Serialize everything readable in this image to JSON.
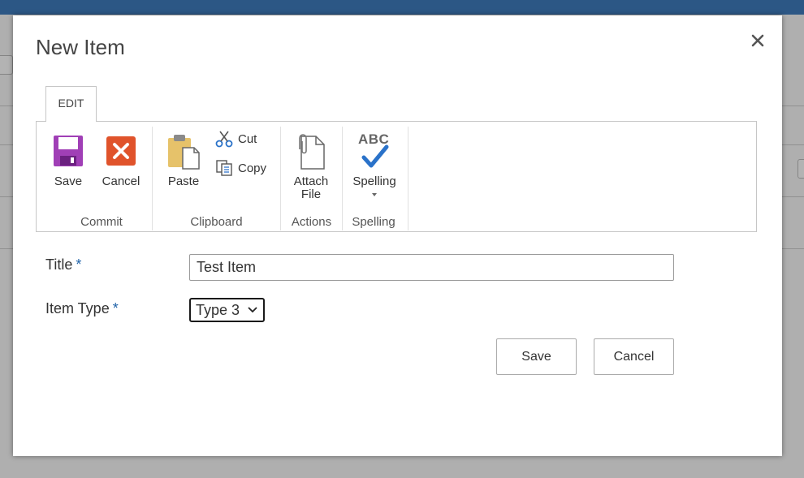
{
  "dialog": {
    "title": "New Item",
    "close_label": "✕"
  },
  "ribbon": {
    "tab_label": "EDIT",
    "groups": {
      "commit": {
        "label": "Commit",
        "save_label": "Save",
        "cancel_label": "Cancel"
      },
      "clipboard": {
        "label": "Clipboard",
        "paste_label": "Paste",
        "cut_label": "Cut",
        "copy_label": "Copy"
      },
      "actions": {
        "label": "Actions",
        "attach_label_line1": "Attach",
        "attach_label_line2": "File"
      },
      "spelling": {
        "label": "Spelling",
        "spelling_label": "Spelling",
        "icon_text": "ABC"
      }
    }
  },
  "form": {
    "title_label": "Title",
    "title_required": "*",
    "title_value": "Test Item",
    "item_type_label": "Item Type",
    "item_type_required": "*",
    "item_type_value": "Type 3",
    "save_button": "Save",
    "cancel_button": "Cancel"
  },
  "colors": {
    "top_bar": "#1f62a8",
    "required_marker": "#1f62a8",
    "save_icon": "#a03fb6",
    "cancel_icon": "#e0532b",
    "spelling_check": "#2a72c9"
  }
}
